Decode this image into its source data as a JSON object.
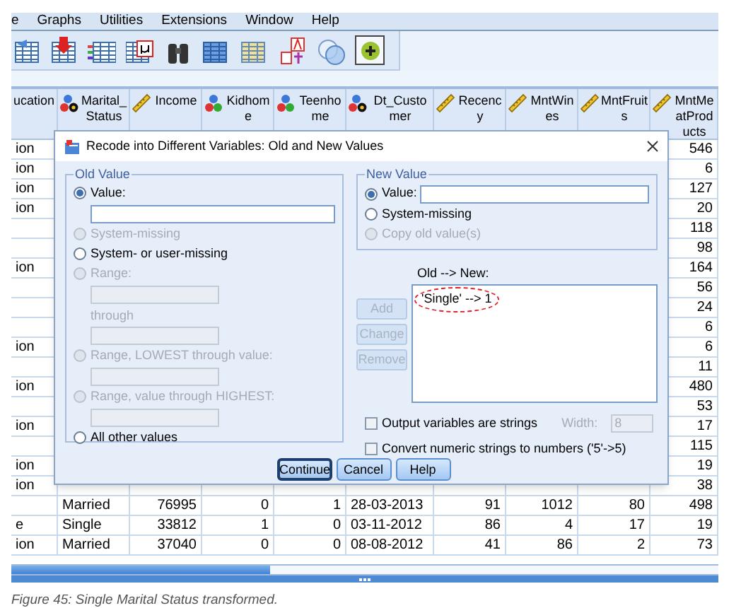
{
  "menu_bar": [
    {
      "label": "e"
    },
    {
      "label": "Graphs"
    },
    {
      "label": "Utilities"
    },
    {
      "label": "Extensions"
    },
    {
      "label": "Window"
    },
    {
      "label": "Help"
    }
  ],
  "data_view": {
    "columns": [
      {
        "heading": "ucation"
      },
      {
        "heading": "Marital_Status"
      },
      {
        "heading": "Income"
      },
      {
        "heading": "Kidhome"
      },
      {
        "heading": "Teenhome"
      },
      {
        "heading": "Dt_Customer"
      },
      {
        "heading": "Recency"
      },
      {
        "heading": "MntWines"
      },
      {
        "heading": "MntFruits"
      },
      {
        "heading": "MntMeatProducts"
      }
    ],
    "rows_behind_dialog": [
      {
        "column_1": "ion",
        "last": "546"
      },
      {
        "column_1": "ion",
        "last": "6"
      },
      {
        "column_1": "ion",
        "last": "127"
      },
      {
        "column_1": "ion",
        "last": "20"
      },
      {
        "last": "118"
      },
      {
        "last": "98"
      },
      {
        "column_1": "ion",
        "last": "164"
      },
      {
        "last": "56"
      },
      {
        "last": "24"
      },
      {
        "last": "6"
      },
      {
        "column_1": "ion",
        "last": "6"
      },
      {
        "last": "11"
      },
      {
        "column_1": "ion",
        "last": "480"
      },
      {
        "last": "53"
      },
      {
        "column_1": "ion",
        "last": "17"
      },
      {
        "last": "115"
      },
      {
        "column_1": "ion",
        "last": "19"
      },
      {
        "column_1": "ion",
        "last": "38"
      }
    ],
    "rows": [
      [
        null,
        "Married",
        "76995",
        "0",
        "1",
        "28-03-2013",
        "91",
        "1012",
        "80",
        "498"
      ],
      [
        "e",
        "Single",
        "33812",
        "1",
        "0",
        "03-11-2012",
        "86",
        "4",
        "17",
        "19"
      ],
      [
        "ion",
        "Married",
        "37040",
        "0",
        "0",
        "08-08-2012",
        "41",
        "86",
        "2",
        "73"
      ]
    ]
  },
  "dialog": {
    "title": "Recode into Different Variables: Old and New Values",
    "old_value": {
      "title": "Old Value",
      "items": [
        {
          "kind": "radio",
          "label": "Value:",
          "selected": true,
          "disabled": false
        },
        {
          "kind": "field",
          "disabled": false
        },
        {
          "kind": "radio",
          "label": "System-missing",
          "selected": false,
          "disabled": true
        },
        {
          "kind": "radio",
          "label": "System- or user-missing",
          "selected": false,
          "disabled": false
        },
        {
          "kind": "radio",
          "label": "Range:",
          "selected": false,
          "disabled": true
        },
        {
          "kind": "field",
          "disabled": true
        },
        {
          "kind": "label",
          "label": "through",
          "disabled": true
        },
        {
          "kind": "field",
          "disabled": true
        },
        {
          "kind": "radio",
          "label": "Range, LOWEST through value:",
          "selected": false,
          "disabled": true
        },
        {
          "kind": "field",
          "disabled": true
        },
        {
          "kind": "radio",
          "label": "Range, value through HIGHEST:",
          "selected": false,
          "disabled": true
        },
        {
          "kind": "field",
          "disabled": true
        },
        {
          "kind": "radio",
          "label": "All other values",
          "selected": false,
          "disabled": false
        }
      ]
    },
    "new_value": {
      "title": "New Value",
      "items": [
        {
          "kind": "radio_field",
          "label": "Value:",
          "selected": true,
          "disabled": false
        },
        {
          "kind": "radio",
          "label": "System-missing",
          "selected": false,
          "disabled": false
        },
        {
          "kind": "radio",
          "label": "Copy old value(s)",
          "selected": false,
          "disabled": true
        }
      ]
    },
    "list_label": "Old --> New:",
    "list_items": [
      {
        "label": "'Single' --> 1",
        "highlighted": true
      }
    ],
    "list_buttons": [
      {
        "label": "Add",
        "disabled": true
      },
      {
        "label": "Change",
        "disabled": true
      },
      {
        "label": "Remove",
        "disabled": true
      }
    ],
    "options": [
      {
        "label": "Output variables are strings",
        "checked": false
      },
      {
        "label": "Convert numeric strings to numbers ('5'->5)",
        "checked": false
      }
    ],
    "width": {
      "label": "Width:",
      "value": "8",
      "disabled": true
    },
    "buttons": [
      {
        "label": "Continue",
        "default": true
      },
      {
        "label": "Cancel",
        "default": false
      },
      {
        "label": "Help",
        "default": false
      }
    ]
  },
  "caption": "Figure 45: Single Marital Status transformed."
}
